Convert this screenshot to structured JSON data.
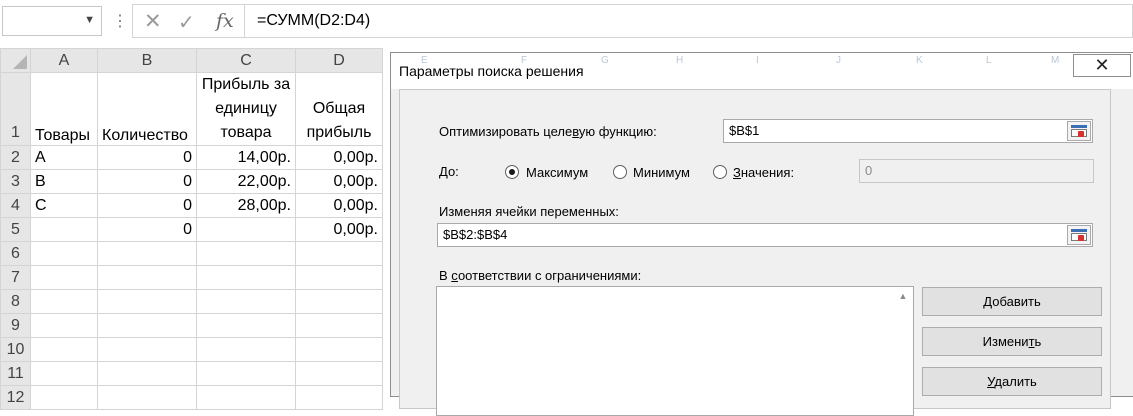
{
  "formula_bar": {
    "name_box": "",
    "separator": "⋮",
    "cancel_icon": "✕",
    "enter_icon": "✓",
    "fx_label": "fx",
    "formula": "=СУММ(D2:D4)"
  },
  "sheet": {
    "columns": [
      "A",
      "B",
      "C",
      "D"
    ],
    "header_row": {
      "row_label": "1",
      "a": "Товары",
      "b": "Количество",
      "c": "Прибыль за единицу товара",
      "d": "Общая прибыль"
    },
    "rows": [
      {
        "row_label": "2",
        "a": "A",
        "b": "0",
        "c": "14,00р.",
        "d": "0,00р."
      },
      {
        "row_label": "3",
        "a": "B",
        "b": "0",
        "c": "22,00р.",
        "d": "0,00р."
      },
      {
        "row_label": "4",
        "a": "C",
        "b": "0",
        "c": "28,00р.",
        "d": "0,00р."
      },
      {
        "row_label": "5",
        "a": "",
        "b": "0",
        "c": "",
        "d": "0,00р."
      },
      {
        "row_label": "6",
        "a": "",
        "b": "",
        "c": "",
        "d": ""
      },
      {
        "row_label": "7",
        "a": "",
        "b": "",
        "c": "",
        "d": ""
      },
      {
        "row_label": "8",
        "a": "",
        "b": "",
        "c": "",
        "d": ""
      },
      {
        "row_label": "9",
        "a": "",
        "b": "",
        "c": "",
        "d": ""
      },
      {
        "row_label": "10",
        "a": "",
        "b": "",
        "c": "",
        "d": ""
      },
      {
        "row_label": "11",
        "a": "",
        "b": "",
        "c": "",
        "d": ""
      },
      {
        "row_label": "12",
        "a": "",
        "b": "",
        "c": "",
        "d": ""
      }
    ]
  },
  "dialog": {
    "title": "Параметры поиска решения",
    "close_icon": "✕",
    "background_column_headers": [
      "E",
      "F",
      "G",
      "H",
      "I",
      "J",
      "K",
      "L",
      "M"
    ],
    "objective_label_pre": "Оптимизировать целе",
    "objective_label_key": "в",
    "objective_label_post": "ую функцию:",
    "objective_value": "$B$1",
    "to_label": "До:",
    "radio_max": "Максимум",
    "radio_min": "Минимум",
    "radio_value_key": "З",
    "radio_value_rest": "начения:",
    "value_field": "0",
    "selected_option": "Максимум",
    "changing_label": "Изменяя ячейки переменных:",
    "changing_value": "$B$2:$B$4",
    "constraints_label_pre": "В ",
    "constraints_label_key": "с",
    "constraints_label_post": "оответствии с ограничениями:",
    "add_key": "Д",
    "add_rest": "обавить",
    "change_pre": "Измени",
    "change_key": "т",
    "change_post": "ь",
    "delete_key": "У",
    "delete_rest": "далить"
  },
  "colors": {
    "header_gray": "#e6e6e6",
    "dialog_bg": "#f0f0f0",
    "button_bg": "#e1e1e1",
    "gridline": "#d4d4d4"
  }
}
